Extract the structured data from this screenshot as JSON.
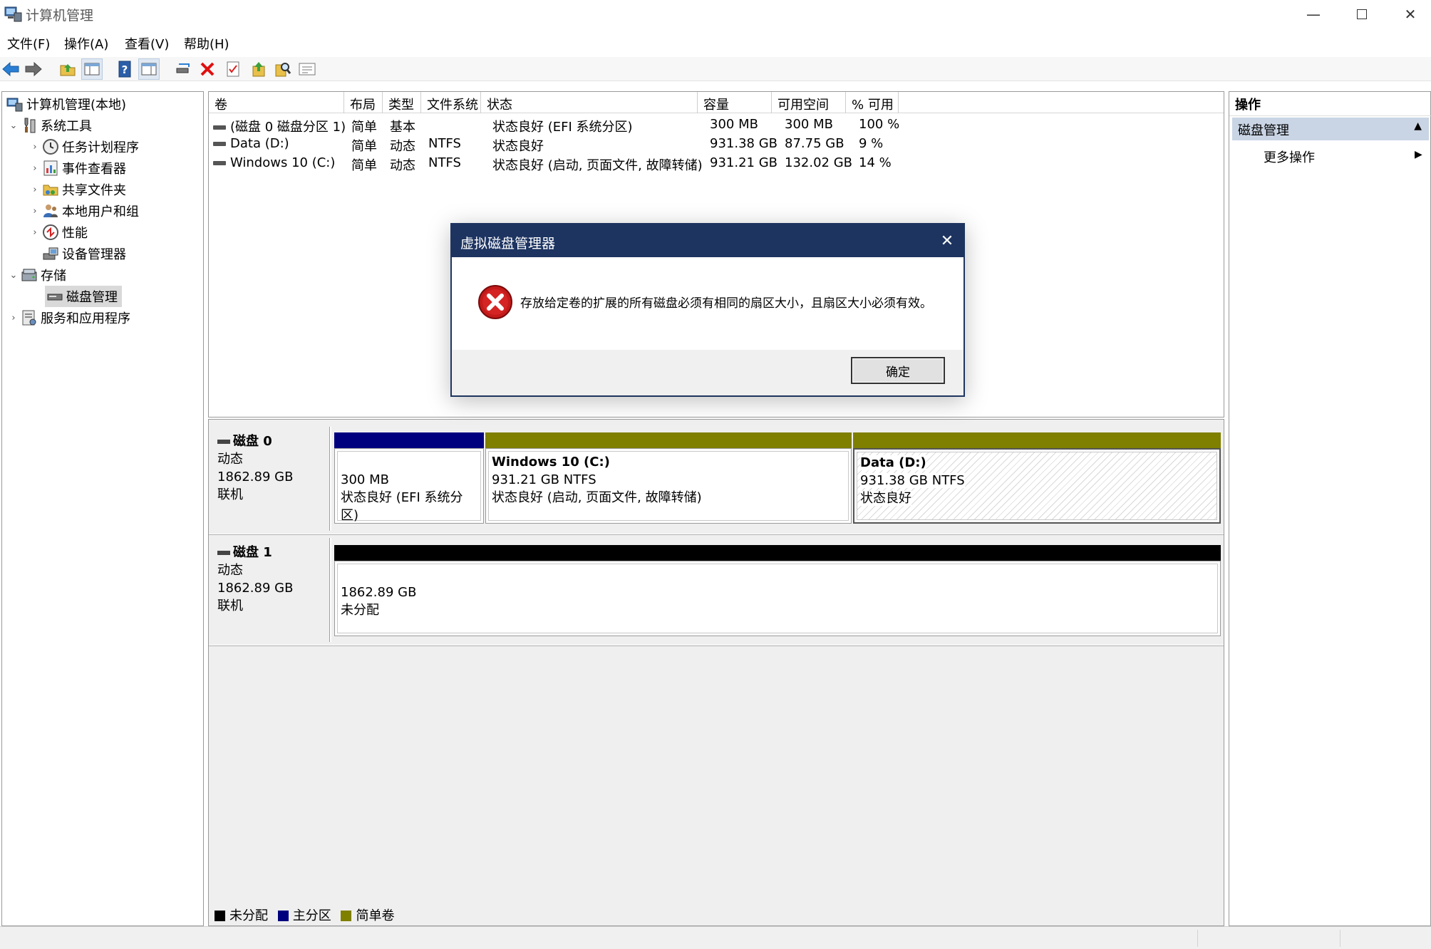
{
  "window": {
    "title": "计算机管理",
    "controls": [
      "minimize-icon",
      "maximize-icon",
      "close-icon"
    ]
  },
  "menu": [
    "文件(F)",
    "操作(A)",
    "查看(V)",
    "帮助(H)"
  ],
  "toolbar_icons": [
    "back-icon",
    "forward-icon",
    "up-folder-icon",
    "show-hide-tree-icon",
    "help-icon",
    "console-view-icon",
    "connect-icon",
    "delete-icon",
    "properties-icon",
    "export-icon",
    "search-icon",
    "list-view-icon"
  ],
  "tree": {
    "root": "计算机管理(本地)",
    "system_tools": "系统工具",
    "task_scheduler": "任务计划程序",
    "event_viewer": "事件查看器",
    "shared_folders": "共享文件夹",
    "local_users": "本地用户和组",
    "performance": "性能",
    "device_manager": "设备管理器",
    "storage": "存储",
    "disk_management": "磁盘管理",
    "services_apps": "服务和应用程序"
  },
  "volume_list": {
    "headers": [
      "卷",
      "布局",
      "类型",
      "文件系统",
      "状态",
      "容量",
      "可用空间",
      "% 可用"
    ],
    "rows": [
      [
        "(磁盘 0 磁盘分区 1)",
        "简单",
        "基本",
        "",
        "状态良好 (EFI 系统分区)",
        "300 MB",
        "300 MB",
        "100 %"
      ],
      [
        "Data (D:)",
        "简单",
        "动态",
        "NTFS",
        "状态良好",
        "931.38 GB",
        "87.75 GB",
        "9 %"
      ],
      [
        "Windows 10 (C:)",
        "简单",
        "动态",
        "NTFS",
        "状态良好 (启动, 页面文件, 故障转储)",
        "931.21 GB",
        "132.02 GB",
        "14 %"
      ]
    ]
  },
  "disks": {
    "disk0": {
      "name": "磁盘 0",
      "type": "动态",
      "size": "1862.89 GB",
      "status": "联机",
      "partitions": [
        {
          "name": "",
          "size": "300 MB",
          "status": "状态良好 (EFI 系统分区)"
        },
        {
          "name": "Windows 10  (C:)",
          "size": "931.21 GB NTFS",
          "status": "状态良好 (启动, 页面文件, 故障转储)"
        },
        {
          "name": "Data  (D:)",
          "size": "931.38 GB NTFS",
          "status": "状态良好"
        }
      ]
    },
    "disk1": {
      "name": "磁盘 1",
      "type": "动态",
      "size": "1862.89 GB",
      "status": "联机",
      "partitions": [
        {
          "size": "1862.89 GB",
          "status": "未分配"
        }
      ]
    }
  },
  "legend": [
    {
      "label": "未分配",
      "color": "#000000"
    },
    {
      "label": "主分区",
      "color": "#00007f"
    },
    {
      "label": "简单卷",
      "color": "#7f7f00"
    }
  ],
  "colors": {
    "primary": "#00007f",
    "simple": "#7f7f00",
    "unallocated": "#000000",
    "dialog_title": "#1d3461",
    "action_section": "#c9d5e4"
  },
  "actions": {
    "header": "操作",
    "section": "磁盘管理",
    "more": "更多操作"
  },
  "dialog": {
    "title": "虚拟磁盘管理器",
    "message": "存放给定卷的扩展的所有磁盘必须有相同的扇区大小，且扇区大小必须有效。",
    "ok": "确定",
    "icon": "error-icon"
  }
}
